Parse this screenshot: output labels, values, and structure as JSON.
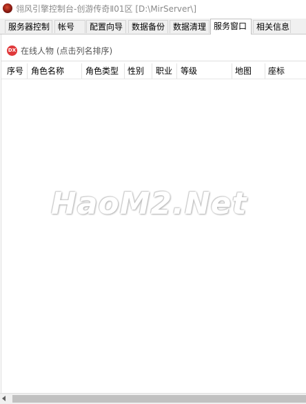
{
  "window": {
    "title": "翎风引擎控制台-创游传奇Ⅱ01区 [D:\\MirServer\\]"
  },
  "tabs": [
    {
      "label": "服务器控制",
      "active": false
    },
    {
      "label": "帐号",
      "active": false
    },
    {
      "label": "配置向导",
      "active": false
    },
    {
      "label": "数据备份",
      "active": false
    },
    {
      "label": "数据清理",
      "active": false
    },
    {
      "label": "服务窗口",
      "active": true
    },
    {
      "label": "相关信息",
      "active": false
    }
  ],
  "panel": {
    "icon_text": "DX",
    "title": "在线人物 (点击列名排序)"
  },
  "table": {
    "columns": [
      "序号",
      "角色名称",
      "角色类型",
      "性别",
      "职业",
      "等级",
      "地图",
      "座标"
    ],
    "rows": []
  },
  "watermark": "HaoM2.Net",
  "colors": {
    "active_tab": "#ffffff",
    "tab_bg": "#f0f0f0",
    "dx_icon": "#e0393b",
    "scroll_thumb": "#c1c1c1"
  }
}
